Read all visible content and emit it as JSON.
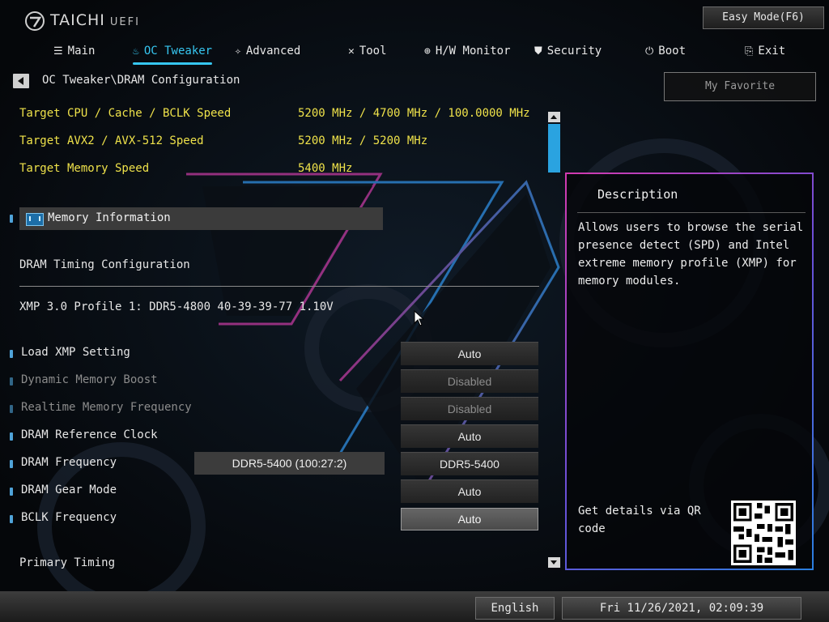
{
  "header": {
    "brand": "TAICHI",
    "brand_suffix": "UEFI",
    "easy_mode_label": "Easy Mode(F6)"
  },
  "tabs": [
    {
      "label": "Main",
      "icon": "list-icon"
    },
    {
      "label": "OC Tweaker",
      "icon": "flame-icon",
      "active": true
    },
    {
      "label": "Advanced",
      "icon": "star-icon"
    },
    {
      "label": "Tool",
      "icon": "tools-icon"
    },
    {
      "label": "H/W Monitor",
      "icon": "monitor-icon"
    },
    {
      "label": "Security",
      "icon": "shield-icon"
    },
    {
      "label": "Boot",
      "icon": "power-icon"
    },
    {
      "label": "Exit",
      "icon": "exit-icon"
    }
  ],
  "breadcrumb": "OC Tweaker\\DRAM Configuration",
  "favorite_label": "My Favorite",
  "targets": [
    {
      "label": "Target CPU / Cache / BCLK Speed",
      "value": "5200 MHz / 4700 MHz / 100.0000 MHz"
    },
    {
      "label": "Target AVX2 / AVX-512 Speed",
      "value": "5200 MHz / 5200 MHz"
    },
    {
      "label": "Target Memory Speed",
      "value": "5400 MHz"
    }
  ],
  "memory_information": "Memory Information",
  "dram_timing_title": "DRAM Timing Configuration",
  "xmp_profile": "XMP 3.0 Profile 1: DDR5-4800 40-39-39-77 1.10V",
  "settings": [
    {
      "label": "Load XMP Setting",
      "value": "Auto",
      "disabled": false
    },
    {
      "label": "Dynamic Memory Boost",
      "value": "Disabled",
      "disabled": true
    },
    {
      "label": "Realtime Memory Frequency",
      "value": "Disabled",
      "disabled": true
    },
    {
      "label": "DRAM Reference Clock",
      "value": "Auto",
      "disabled": false
    },
    {
      "label": "DRAM Frequency",
      "value": "DDR5-5400",
      "current": "DDR5-5400 (100:27:2)",
      "disabled": false
    },
    {
      "label": "DRAM Gear Mode",
      "value": "Auto",
      "disabled": false
    },
    {
      "label": "BCLK Frequency",
      "value": "Auto",
      "disabled": false,
      "selected": true
    }
  ],
  "primary_timing": "Primary Timing",
  "description": {
    "title": "Description",
    "text": "Allows users to browse the serial presence detect (SPD) and Intel extreme memory profile (XMP) for memory modules.",
    "qr_text": "Get details via QR code"
  },
  "footer": {
    "language": "English",
    "datetime": "Fri 11/26/2021, 02:09:39"
  },
  "colors": {
    "accent": "#36c6f0",
    "target_text": "#efe24a",
    "disabled_text": "#8b8b8b"
  }
}
